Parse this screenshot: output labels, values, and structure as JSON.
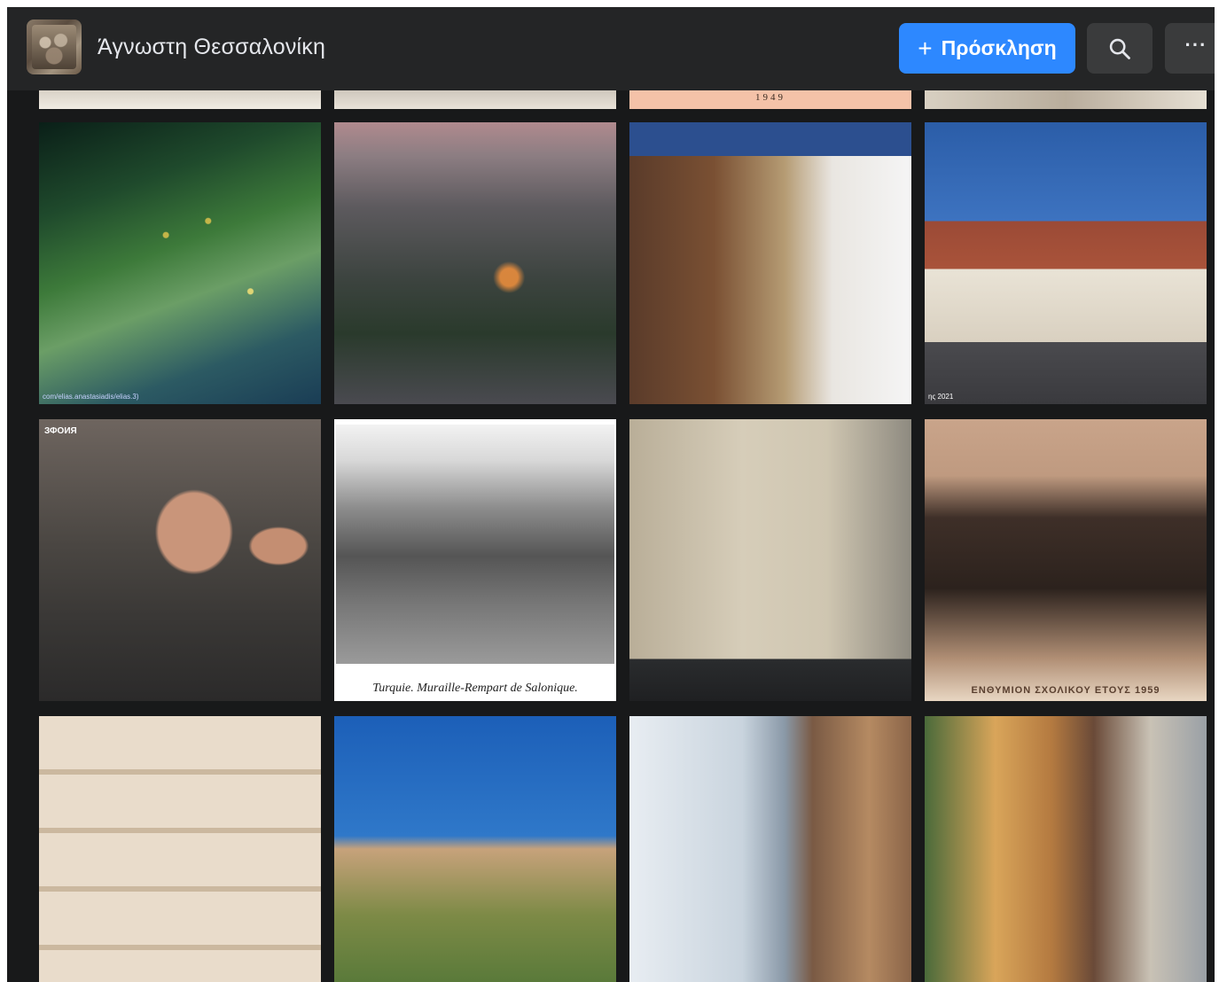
{
  "header": {
    "group_name": "Άγνωστη Θεσσαλονίκη",
    "invite_label": "Πρόσκληση",
    "more_label": "···"
  },
  "photos": {
    "top_strip": [
      {
        "name": "photo-strip-1",
        "caption": ""
      },
      {
        "name": "photo-strip-2",
        "caption": ""
      },
      {
        "name": "photo-strip-3",
        "caption": "1949"
      },
      {
        "name": "photo-strip-4",
        "caption": ""
      }
    ],
    "row1": [
      {
        "name": "photo-waterfront-night",
        "corner": "com/elias.anastasiadis/elias.3)"
      },
      {
        "name": "photo-city-dusk-street",
        "corner": ""
      },
      {
        "name": "photo-ottoman-house",
        "corner": ""
      },
      {
        "name": "photo-old-church",
        "corner": "ης 2021"
      }
    ],
    "row2": [
      {
        "name": "photo-colorized-men",
        "corner": "",
        "badge": "ЗФОИЯ"
      },
      {
        "name": "photo-rampart-postcard",
        "caption": "Turquie.   Muraille-Rempart de Salonique."
      },
      {
        "name": "photo-building-facade",
        "corner": ""
      },
      {
        "name": "photo-school-group",
        "caption": "ΕΝΘΥΜΙΟΝ ΣΧΟΛΙΚΟΥ ΕΤΟΥΣ 1959"
      }
    ],
    "row3": [
      {
        "name": "photo-hotel-balconies"
      },
      {
        "name": "photo-tree-castle"
      },
      {
        "name": "photo-sea-view-house"
      },
      {
        "name": "photo-narrow-street"
      }
    ]
  },
  "colors": {
    "accent": "#2d88ff",
    "header_bg": "#242526",
    "page_bg": "#18191a"
  }
}
